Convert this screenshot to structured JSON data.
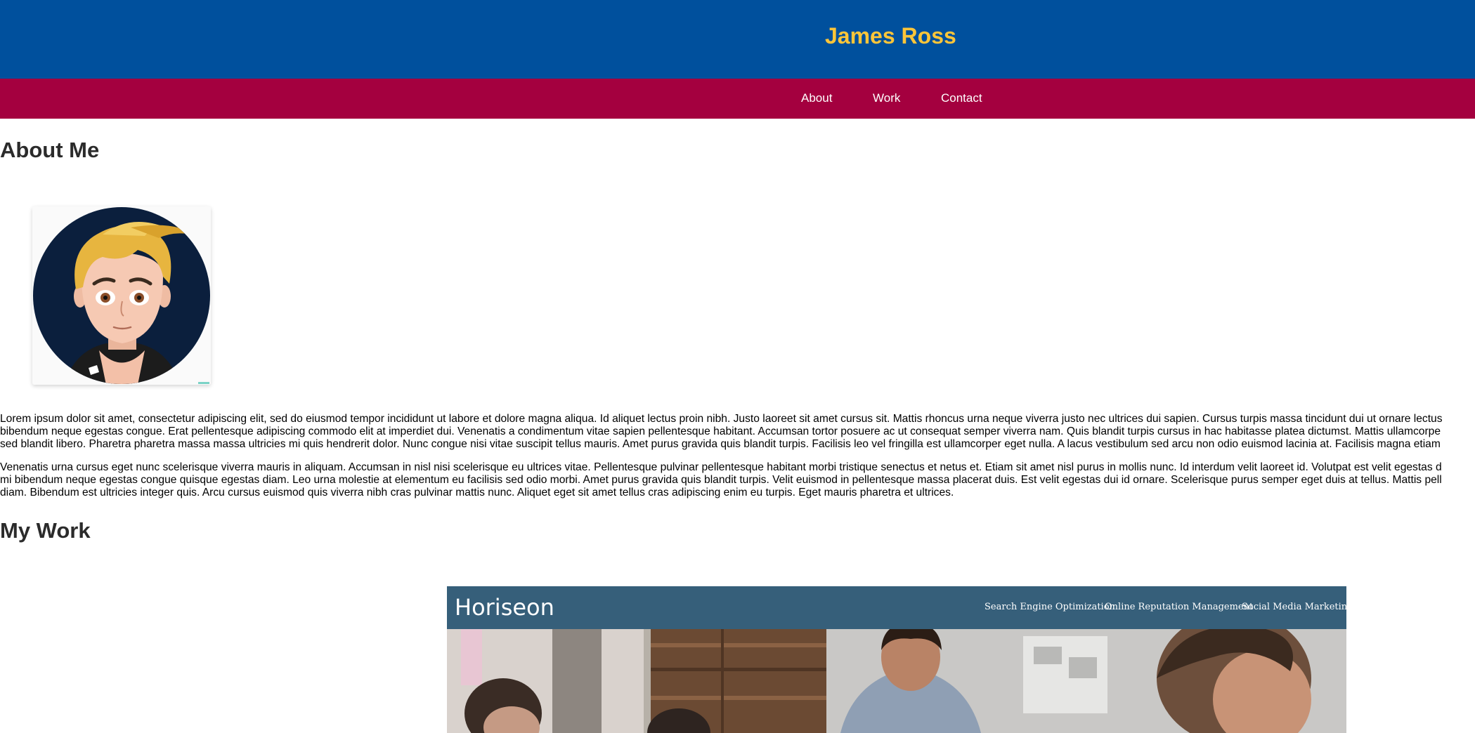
{
  "header": {
    "title": "James Ross"
  },
  "nav": {
    "about": "About",
    "work": "Work",
    "contact": "Contact"
  },
  "about": {
    "heading": "About Me",
    "avatar_icon": "cartoon-portrait",
    "paragraph1_lines": [
      "Lorem ipsum dolor sit amet, consectetur adipiscing elit, sed do eiusmod tempor incididunt ut labore et dolore magna aliqua. Id aliquet lectus proin nibh. Justo laoreet sit amet cursus sit. Mattis rhoncus urna neque viverra justo nec ultrices dui sapien. Cursus turpis massa tincidunt dui ut ornare lectus",
      "bibendum neque egestas congue. Erat pellentesque adipiscing commodo elit at imperdiet dui. Venenatis a condimentum vitae sapien pellentesque habitant. Accumsan tortor posuere ac ut consequat semper viverra nam. Quis blandit turpis cursus in hac habitasse platea dictumst. Mattis ullamcorpe",
      "sed blandit libero. Pharetra pharetra massa massa ultricies mi quis hendrerit dolor. Nunc congue nisi vitae suscipit tellus mauris. Amet purus gravida quis blandit turpis. Facilisis leo vel fringilla est ullamcorper eget nulla. A lacus vestibulum sed arcu non odio euismod lacinia at. Facilisis magna etiam"
    ],
    "paragraph2_lines": [
      "Venenatis urna cursus eget nunc scelerisque viverra mauris in aliquam. Accumsan in nisl nisi scelerisque eu ultrices vitae. Pellentesque pulvinar pellentesque habitant morbi tristique senectus et netus et. Etiam sit amet nisl purus in mollis nunc. Id interdum velit laoreet id. Volutpat est velit egestas d",
      "mi bibendum neque egestas congue quisque egestas diam. Leo urna molestie at elementum eu facilisis sed odio morbi. Amet purus gravida quis blandit turpis. Velit euismod in pellentesque massa placerat duis. Est velit egestas dui id ornare. Scelerisque purus semper eget duis at tellus. Mattis pell",
      "diam. Bibendum est ultricies integer quis. Arcu cursus euismod quis viverra nibh cras pulvinar mattis nunc. Aliquet eget sit amet tellus cras adipiscing enim eu turpis. Eget mauris pharetra et ultrices."
    ]
  },
  "work": {
    "heading": "My Work",
    "project": {
      "logo": "Horiseon",
      "nav": [
        "Search Engine Optimization",
        "Online Reputation Management",
        "Social Media Marketing"
      ],
      "photo_icon": "team-meeting-photo"
    }
  },
  "colors": {
    "header_bg": "#00509d",
    "title": "#fdc539",
    "nav_bg": "#a4003f",
    "project_header_bg": "#365f7a"
  }
}
